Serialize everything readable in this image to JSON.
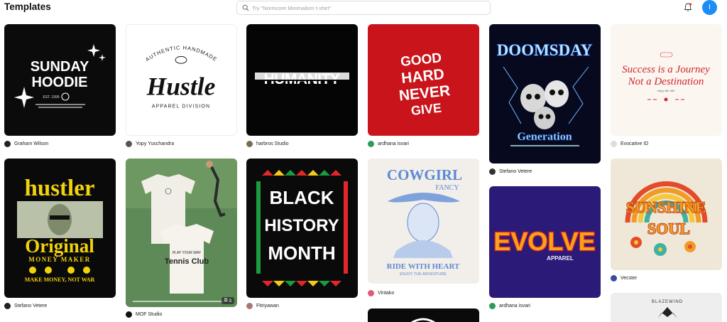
{
  "header": {
    "title": "Templates",
    "search_placeholder": "Try \"Normcore Minimalism t-shirt\"",
    "avatar_initial": "I"
  },
  "colors": {
    "accent": "#1c8df4"
  },
  "cards": [
    {
      "id": "c1",
      "author": "Graham Wilson",
      "design_text": [
        "SUNDAY",
        "HOODIE",
        "EST. 1999"
      ]
    },
    {
      "id": "c2",
      "author": "Yopy Yuschandra",
      "design_text": [
        "AUTHENTIC HANDMADE",
        "Hustle",
        "APPAREL DIVISION"
      ]
    },
    {
      "id": "c3",
      "author": "harbros Studio",
      "design_text": [
        "HUMANITY"
      ]
    },
    {
      "id": "c4",
      "author": "ardhana isvari",
      "design_text": [
        "GOOD",
        "HARD",
        "NEVER",
        "GIVE"
      ]
    },
    {
      "id": "c5",
      "author": "Stefano Vetere",
      "design_text": [
        "DOOMSDAY",
        "Generation"
      ]
    },
    {
      "id": "c6",
      "author": "Evocative ID",
      "design_text": [
        "Success is a Journey",
        "Not a Destination",
        "enjoy the ride"
      ]
    },
    {
      "id": "c7",
      "author": "Stefano Vetere",
      "design_text": [
        "hustler",
        "Original",
        "MONEY MAKER",
        "MAKE MONEY, NOT WAR"
      ]
    },
    {
      "id": "c8",
      "author": "MOF Studio",
      "pages": "3",
      "design_text": [
        "Tennis Club",
        "PLAY YOUR WAY"
      ]
    },
    {
      "id": "c9",
      "author": "Fitriyawan",
      "design_text": [
        "BLACK",
        "HISTORY",
        "MONTH"
      ]
    },
    {
      "id": "c10",
      "author": "Vintako",
      "design_text": [
        "COWGIRL",
        "FANCY",
        "RIDE WITH HEART",
        "ENJOY THE ADVENTURE"
      ]
    },
    {
      "id": "c11",
      "author": "ardhana isvari",
      "design_text": [
        "EVOLVE",
        "APPAREL"
      ]
    },
    {
      "id": "c12",
      "author": "Vecster",
      "design_text": [
        "SUNSHINE",
        "SOUL"
      ]
    },
    {
      "id": "c13",
      "design_text": [
        "BLAZEWIND"
      ]
    }
  ]
}
